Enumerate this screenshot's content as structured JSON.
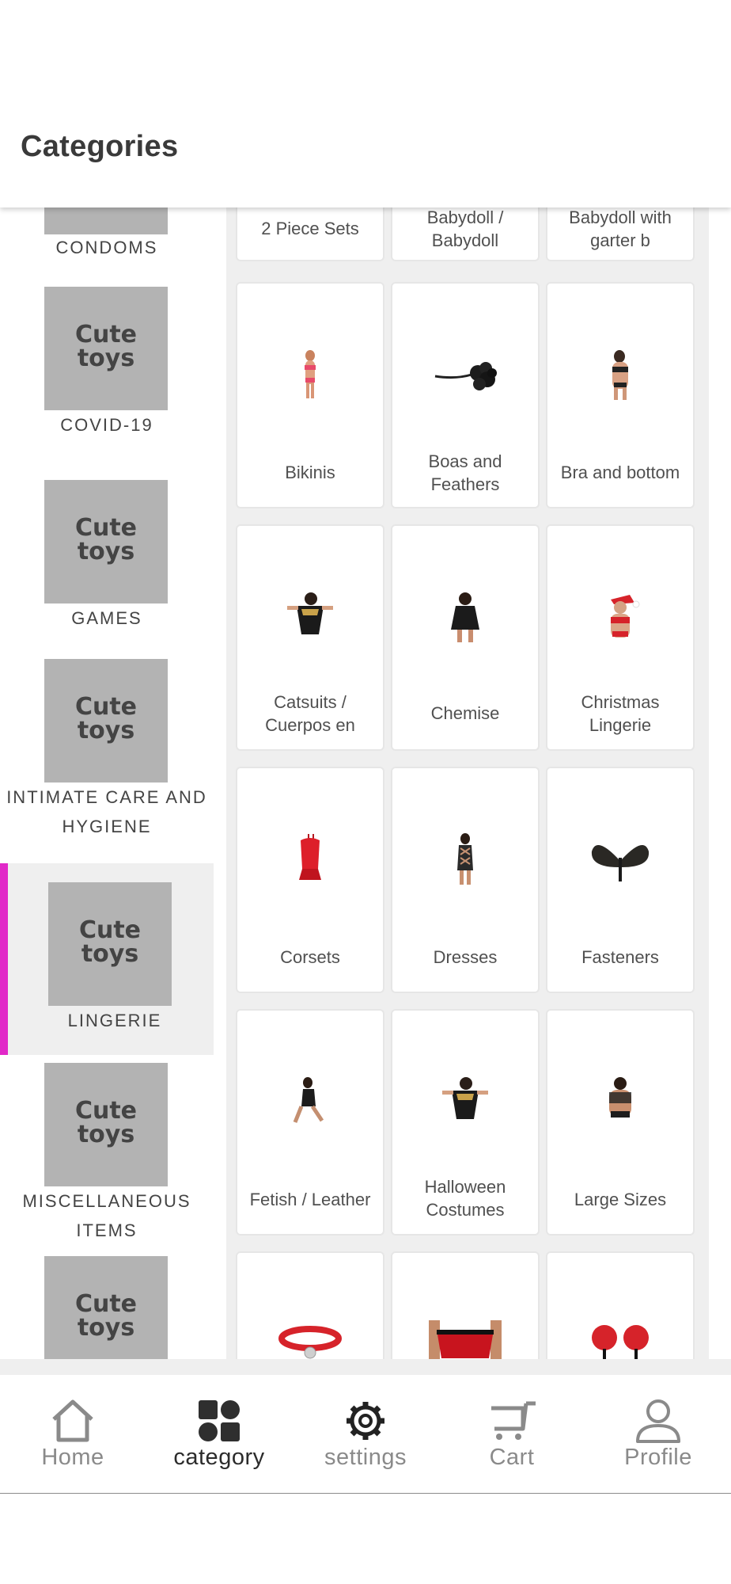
{
  "header": {
    "title": "Categories"
  },
  "sidebar": {
    "logo_text": "Cute toys",
    "items": [
      {
        "label": "CONDOMS",
        "label_lines": [
          "CONDOMS"
        ]
      },
      {
        "label": "COVID-19",
        "label_lines": [
          "COVID-19"
        ]
      },
      {
        "label": "GAMES",
        "label_lines": [
          "GAMES"
        ]
      },
      {
        "label": "INTIMATE CARE AND HYGIENE",
        "label_lines": [
          "INTIMATE CARE AND",
          "HYGIENE"
        ]
      },
      {
        "label": "LINGERIE",
        "label_lines": [
          "LINGERIE"
        ],
        "selected": true
      },
      {
        "label": "MISCELLANEOUS ITEMS",
        "label_lines": [
          "MISCELLANEOUS",
          "ITEMS"
        ]
      },
      {
        "label": "",
        "label_lines": []
      }
    ]
  },
  "grid": {
    "rows": [
      [
        {
          "label_lines": [
            "2 Piece Sets"
          ],
          "icon": "set-image"
        },
        {
          "label_lines": [
            "Babydoll /",
            "Babydoll"
          ],
          "icon": "babydoll-image"
        },
        {
          "label_lines": [
            "Babydoll with",
            "garter b"
          ],
          "icon": "babydoll-garter-image"
        }
      ],
      [
        {
          "label_lines": [
            "Bikinis"
          ],
          "icon": "bikini-image"
        },
        {
          "label_lines": [
            "Boas and",
            "Feathers"
          ],
          "icon": "feather-boa-image"
        },
        {
          "label_lines": [
            "Bra and bottom"
          ],
          "icon": "bra-bottom-image"
        }
      ],
      [
        {
          "label_lines": [
            "Catsuits /",
            "Cuerpos en"
          ],
          "icon": "catsuit-image"
        },
        {
          "label_lines": [
            "Chemise"
          ],
          "icon": "chemise-image"
        },
        {
          "label_lines": [
            "Christmas",
            "Lingerie"
          ],
          "icon": "christmas-lingerie-image"
        }
      ],
      [
        {
          "label_lines": [
            "Corsets"
          ],
          "icon": "corset-image"
        },
        {
          "label_lines": [
            "Dresses"
          ],
          "icon": "dress-image"
        },
        {
          "label_lines": [
            "Fasteners"
          ],
          "icon": "fastener-image"
        }
      ],
      [
        {
          "label_lines": [
            "Fetish / Leather"
          ],
          "icon": "fetish-image"
        },
        {
          "label_lines": [
            "Halloween",
            "Costumes"
          ],
          "icon": "halloween-costume-image"
        },
        {
          "label_lines": [
            "Large Sizes"
          ],
          "icon": "large-sizes-image"
        }
      ],
      [
        {
          "label_lines": [],
          "icon": "choker-image"
        },
        {
          "label_lines": [],
          "icon": "mens-briefs-image"
        },
        {
          "label_lines": [],
          "icon": "nipple-tassels-image"
        }
      ]
    ]
  },
  "bottom_nav": {
    "items": [
      {
        "label": "Home",
        "icon": "home-icon"
      },
      {
        "label": "category",
        "icon": "category-icon",
        "active": true
      },
      {
        "label": "settings",
        "icon": "gear-icon"
      },
      {
        "label": "Cart",
        "icon": "cart-icon"
      },
      {
        "label": "Profile",
        "icon": "profile-icon"
      }
    ]
  },
  "colors": {
    "accent": "#e128c8",
    "thumb_bg": "#b3b3b3",
    "grid_bg": "#efefef",
    "text": "#444444"
  }
}
